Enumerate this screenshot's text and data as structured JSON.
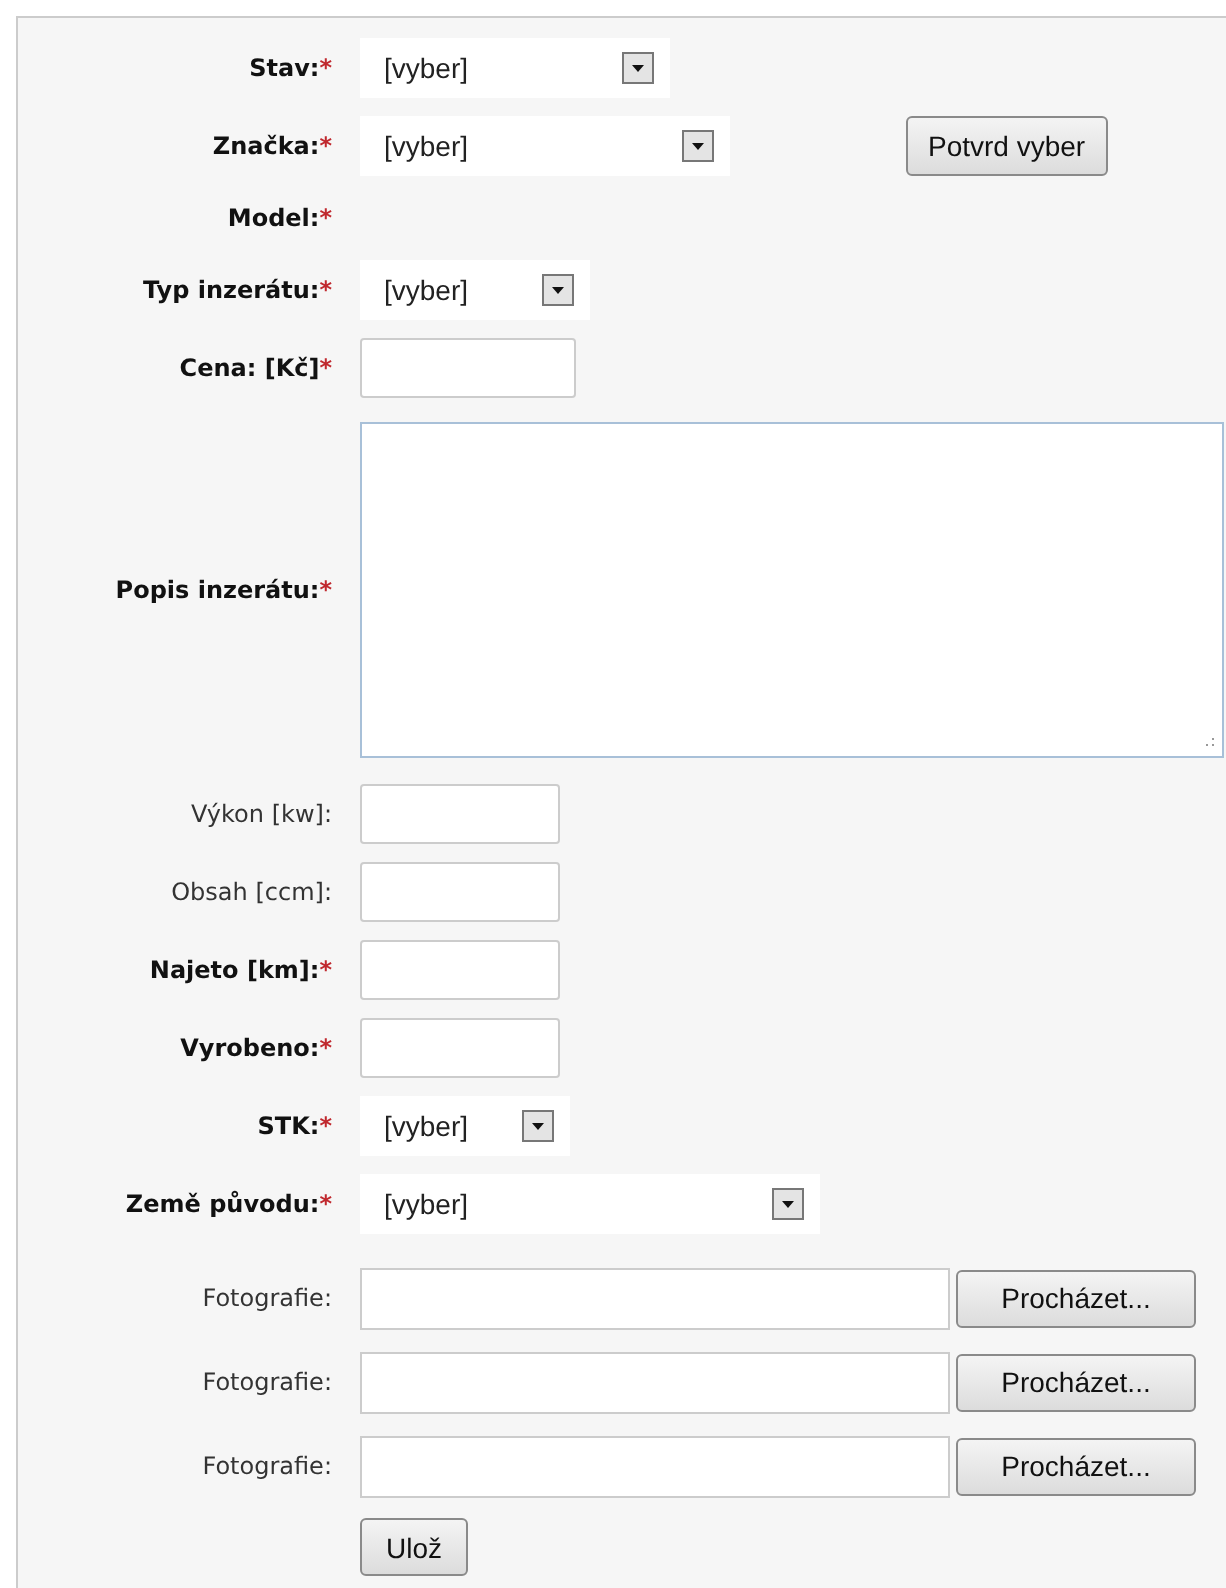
{
  "form": {
    "rows": [
      {
        "label": "Stav:",
        "bold": true,
        "required_mark": "*",
        "control": {
          "kind": "select",
          "value": "[vyber]"
        }
      },
      {
        "label": "Značka:",
        "bold": true,
        "required_mark": "*",
        "control": {
          "kind": "select",
          "value": "[vyber]"
        },
        "button": "Potvrd vyber"
      },
      {
        "label": "Model:",
        "bold": true,
        "required_mark": "*",
        "control": {
          "kind": "none"
        }
      },
      {
        "label": "Typ inzerátu:",
        "bold": true,
        "required_mark": "*",
        "control": {
          "kind": "select",
          "value": "[vyber]"
        }
      },
      {
        "label": "Cena: [Kč]",
        "bold": true,
        "required_mark": "*",
        "control": {
          "kind": "text"
        }
      },
      {
        "label": "Popis inzerátu:",
        "bold": true,
        "required_mark": "*",
        "control": {
          "kind": "textarea"
        }
      },
      {
        "label": "Výkon [kw]:",
        "bold": false,
        "control": {
          "kind": "text"
        }
      },
      {
        "label": "Obsah [ccm]:",
        "bold": false,
        "control": {
          "kind": "text"
        }
      },
      {
        "label": "Najeto [km]:",
        "bold": true,
        "required_mark": "*",
        "control": {
          "kind": "text"
        }
      },
      {
        "label": "Vyrobeno:",
        "bold": true,
        "required_mark": "*",
        "control": {
          "kind": "text"
        }
      },
      {
        "label": "STK:",
        "bold": true,
        "required_mark": "*",
        "control": {
          "kind": "select",
          "value": "[vyber]"
        }
      },
      {
        "label": "Země původu:",
        "bold": true,
        "required_mark": "*",
        "control": {
          "kind": "select",
          "value": "[vyber]"
        }
      },
      {
        "label": "Fotografie:",
        "bold": false,
        "control": {
          "kind": "file",
          "button": "Procházet..."
        }
      },
      {
        "label": "Fotografie:",
        "bold": false,
        "control": {
          "kind": "file",
          "button": "Procházet..."
        }
      },
      {
        "label": "Fotografie:",
        "bold": false,
        "control": {
          "kind": "file",
          "button": "Procházet..."
        }
      }
    ],
    "submit": "Ulož"
  }
}
